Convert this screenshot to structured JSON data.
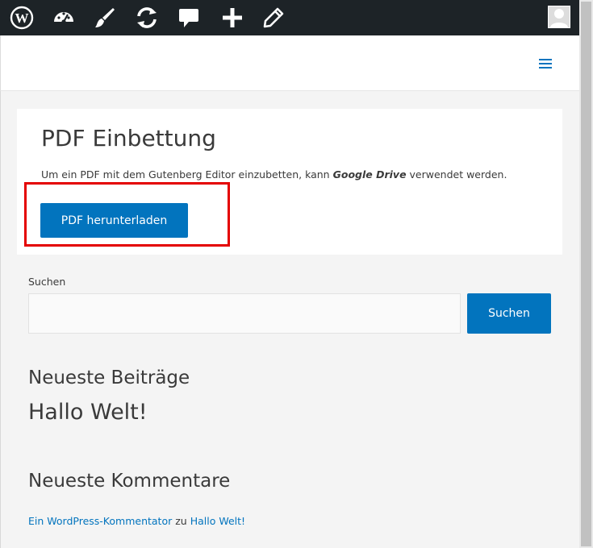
{
  "admin_bar": {
    "icons": [
      "wordpress-icon",
      "dashboard-icon",
      "customize-brush-icon",
      "updates-icon",
      "comments-icon",
      "new-content-icon",
      "edit-pencil-icon"
    ],
    "avatar": "user-avatar"
  },
  "header": {
    "menu_icon": "hamburger-menu-icon"
  },
  "article": {
    "title": "PDF Einbettung",
    "text_before": "Um ein PDF mit dem Gutenberg Editor einzubetten, kann ",
    "text_bold": "Google Drive",
    "text_after": " verwendet werden.",
    "button_label": "PDF herunterladen"
  },
  "search": {
    "label": "Suchen",
    "value": "",
    "button_label": "Suchen"
  },
  "recent_posts": {
    "title": "Neueste Beiträge",
    "items": [
      "Hallo Welt!"
    ]
  },
  "recent_comments": {
    "title": "Neueste Kommentare",
    "author": "Ein WordPress-Kommentator",
    "connector": " zu ",
    "post": "Hallo Welt!"
  },
  "colors": {
    "accent": "#0274be",
    "admin_bar": "#1d2327",
    "highlight": "#e40000"
  }
}
